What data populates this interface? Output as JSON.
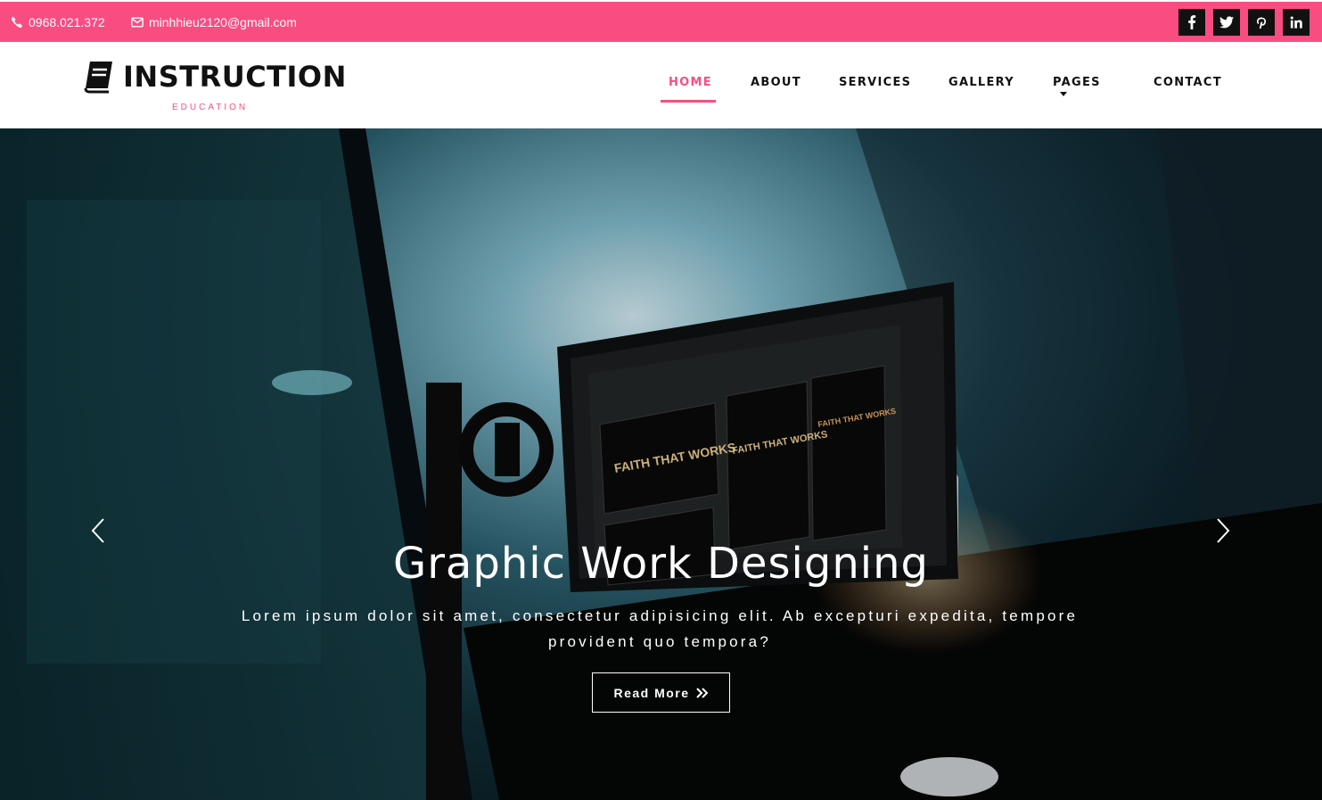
{
  "topbar": {
    "phone": "0968.021.372",
    "email": "minhhieu2120@gmail.com",
    "accent_color": "#f94d82",
    "socials": [
      {
        "icon": "facebook-icon",
        "glyph": "f"
      },
      {
        "icon": "twitter-icon",
        "glyph": "t"
      },
      {
        "icon": "pinterest-icon",
        "glyph": "p"
      },
      {
        "icon": "linkedin-icon",
        "glyph": "in"
      }
    ]
  },
  "brand": {
    "title": "INSTRUCTION",
    "subtitle": "EDUCATION",
    "icon": "book-icon"
  },
  "nav": {
    "items": [
      {
        "label": "HOME",
        "active": true
      },
      {
        "label": "ABOUT"
      },
      {
        "label": "SERVICES"
      },
      {
        "label": "GALLERY"
      },
      {
        "label": "PAGES",
        "dropdown": true
      },
      {
        "label": "CONTACT"
      }
    ]
  },
  "hero": {
    "title": "Graphic Work Designing",
    "text": "Lorem ipsum dolor sit amet, consectetur adipisicing elit. Ab excepturi expedita, tempore provident quo tempora?",
    "button_label": "Read More",
    "prev_icon": "chevron-left-icon",
    "next_icon": "chevron-right-icon",
    "screen_labels": [
      "FAITH THAT WORKS",
      "FAITH THAT WORKS",
      "FAITH THAT WORKS"
    ]
  }
}
